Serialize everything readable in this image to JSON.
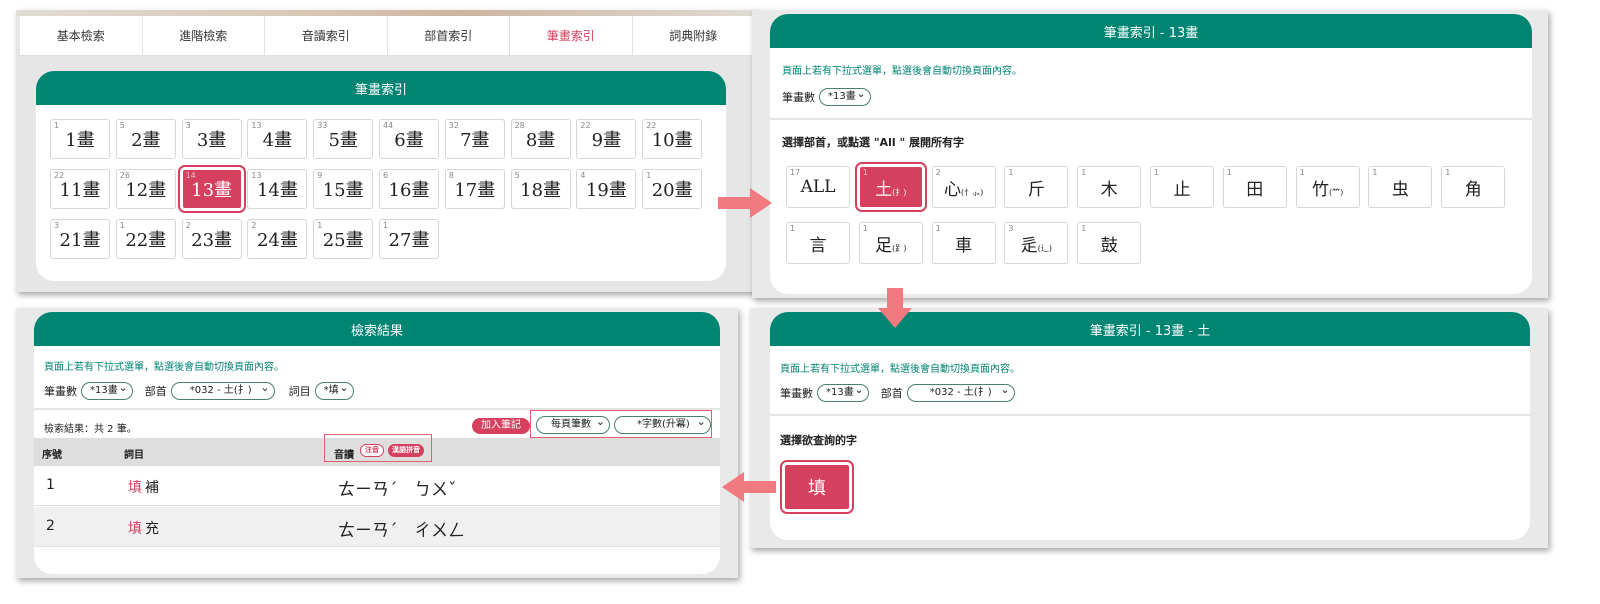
{
  "panel1": {
    "tabs": [
      "基本檢索",
      "進階檢索",
      "音讀索引",
      "部首索引",
      "筆畫索引",
      "詞典附錄"
    ],
    "active_tab": 4,
    "card_title": "筆畫索引",
    "cells": [
      {
        "n": "1",
        "label": "1畫"
      },
      {
        "n": "5",
        "label": "2畫"
      },
      {
        "n": "3",
        "label": "3畫"
      },
      {
        "n": "13",
        "label": "4畫"
      },
      {
        "n": "33",
        "label": "5畫"
      },
      {
        "n": "44",
        "label": "6畫"
      },
      {
        "n": "32",
        "label": "7畫"
      },
      {
        "n": "28",
        "label": "8畫"
      },
      {
        "n": "22",
        "label": "9畫"
      },
      {
        "n": "22",
        "label": "10畫"
      },
      {
        "n": "22",
        "label": "11畫"
      },
      {
        "n": "26",
        "label": "12畫"
      },
      {
        "n": "14",
        "label": "13畫"
      },
      {
        "n": "13",
        "label": "14畫"
      },
      {
        "n": "9",
        "label": "15畫"
      },
      {
        "n": "6",
        "label": "16畫"
      },
      {
        "n": "8",
        "label": "17畫"
      },
      {
        "n": "5",
        "label": "18畫"
      },
      {
        "n": "4",
        "label": "19畫"
      },
      {
        "n": "1",
        "label": "20畫"
      },
      {
        "n": "3",
        "label": "21畫"
      },
      {
        "n": "1",
        "label": "22畫"
      },
      {
        "n": "2",
        "label": "23畫"
      },
      {
        "n": "2",
        "label": "24畫"
      },
      {
        "n": "1",
        "label": "25畫"
      },
      {
        "n": "1",
        "label": "27畫"
      }
    ],
    "selected_index": 12
  },
  "panel2": {
    "title": "筆畫索引 - 13畫",
    "hint": "頁面上若有下拉式選單，點選後會自動切換頁面內容。",
    "stroke_label": "筆畫數",
    "stroke_value": "*13畫",
    "subtitle": "選擇部首，或點選 \"All \" 展開所有字",
    "radicals": [
      {
        "n": "17",
        "ch": "ALL",
        "v": ""
      },
      {
        "n": "1",
        "ch": "土",
        "v": "(扌)"
      },
      {
        "n": "2",
        "ch": "心",
        "v": "(忄⺗)"
      },
      {
        "n": "1",
        "ch": "斤",
        "v": ""
      },
      {
        "n": "1",
        "ch": "木",
        "v": ""
      },
      {
        "n": "1",
        "ch": "止",
        "v": ""
      },
      {
        "n": "1",
        "ch": "田",
        "v": ""
      },
      {
        "n": "1",
        "ch": "竹",
        "v": "(⺮)"
      },
      {
        "n": "1",
        "ch": "虫",
        "v": ""
      },
      {
        "n": "1",
        "ch": "角",
        "v": ""
      },
      {
        "n": "1",
        "ch": "言",
        "v": ""
      },
      {
        "n": "1",
        "ch": "足",
        "v": "(⻊)"
      },
      {
        "n": "1",
        "ch": "車",
        "v": ""
      },
      {
        "n": "3",
        "ch": "辵",
        "v": "(⻌)"
      },
      {
        "n": "1",
        "ch": "鼓",
        "v": ""
      }
    ],
    "selected_index": 1
  },
  "panel3": {
    "title": "筆畫索引 - 13畫 - 土",
    "hint": "頁面上若有下拉式選單，點選後會自動切換頁面內容。",
    "stroke_label": "筆畫數",
    "stroke_value": "*13畫",
    "radical_label": "部首",
    "radical_value": "*032 - 土(扌)",
    "subtitle": "選擇欲查詢的字",
    "char": "填"
  },
  "panel4": {
    "title": "檢索結果",
    "hint": "頁面上若有下拉式選單，點選後會自動切換頁面內容。",
    "stroke_label": "筆畫數",
    "stroke_value": "*13畫",
    "radical_label": "部首",
    "radical_value": "*032 - 土(扌)",
    "entry_label": "詞目",
    "entry_value": "*填",
    "result_count": "檢索結果：共 2 筆。",
    "add_note_button": "加入筆記",
    "per_page_select": "每頁筆數",
    "sort_select": "*字數(升冪)",
    "columns": {
      "no": "序號",
      "entry": "詞目",
      "reading": "音讀"
    },
    "reading_tags": [
      "注音",
      "漢語拼音"
    ],
    "rows": [
      {
        "no": "1",
        "head": "填",
        "tail": "補",
        "zhuyin": [
          "ㄊㄧㄢˊ",
          "ㄅㄨˇ"
        ]
      },
      {
        "no": "2",
        "head": "填",
        "tail": "充",
        "zhuyin": [
          "ㄊㄧㄢˊ",
          "ㄔㄨㄥ"
        ]
      }
    ]
  },
  "colors": {
    "teal": "#008573",
    "accent": "#d6405f",
    "arrow": "#f07a80"
  }
}
